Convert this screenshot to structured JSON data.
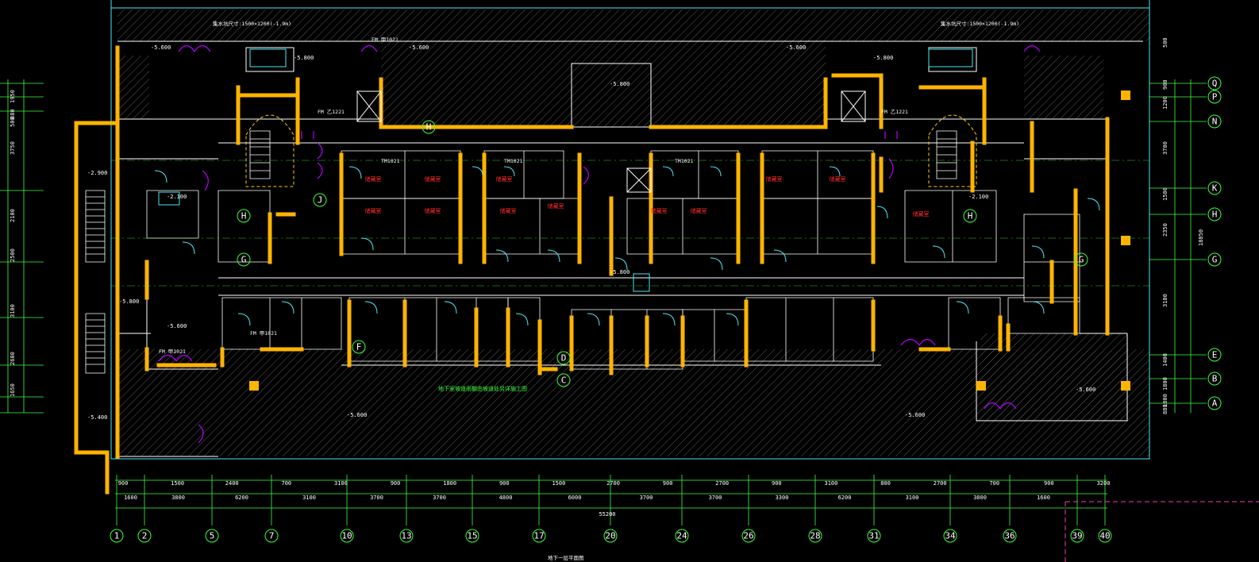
{
  "grid_axes_bottom": [
    "1",
    "2",
    "5",
    "7",
    "10",
    "13",
    "15",
    "17",
    "20",
    "24",
    "26",
    "28",
    "31",
    "34",
    "36",
    "39",
    "40"
  ],
  "grid_axes_right": [
    "Q",
    "P",
    "N",
    "K",
    "H",
    "G",
    "E",
    "B",
    "A"
  ],
  "grid_axes_interior": [
    "H",
    "H",
    "G",
    "G",
    "J",
    "F",
    "D",
    "C",
    "H"
  ],
  "dims_bottom_row1": [
    "900",
    "1500",
    "2400",
    "700",
    "3100",
    "900",
    "1800",
    "900",
    "1500",
    "2700",
    "900",
    "2700",
    "900",
    "3100",
    "800",
    "2700",
    "700",
    "900",
    "3200"
  ],
  "dims_bottom_row2": [
    "1600",
    "3800",
    "6200",
    "3100",
    "3700",
    "3700",
    "4800",
    "6000",
    "3700",
    "3700",
    "3300",
    "6200",
    "3100",
    "3800",
    "1600"
  ],
  "dims_total": "55200",
  "dims_right": [
    "500",
    "900",
    "1200",
    "3700",
    "1500",
    "2350",
    "3100",
    "1400",
    "1800",
    "1800",
    "880"
  ],
  "dims_right_total": "18850",
  "dims_left": [
    "1950",
    "880",
    "500",
    "3750",
    "2100",
    "2500",
    "3100",
    "2600",
    "1650"
  ],
  "rooms": [
    {
      "label": "储藏室"
    },
    {
      "label": "储藏室"
    },
    {
      "label": "储藏室"
    },
    {
      "label": "储藏室"
    },
    {
      "label": "储藏室"
    },
    {
      "label": "储藏室"
    },
    {
      "label": "储藏室"
    },
    {
      "label": "储藏室"
    },
    {
      "label": "储藏室"
    },
    {
      "label": "储藏室"
    },
    {
      "label": "储藏室"
    },
    {
      "label": "储藏室"
    }
  ],
  "elevations": [
    "-5.600",
    "-5.600",
    "-5.600",
    "-5.800",
    "-5.800",
    "-5.800",
    "-2.900",
    "-2.100",
    "-5.400",
    "-5.800",
    "-5.600",
    "-5.600",
    "-5.600",
    "-5.800",
    "-5.600",
    "-2.100"
  ],
  "notes": {
    "ramp": "地下室坡道雨棚由坡道处另详施工图",
    "stair_top_left": "集水坑尺寸:1500×1200(-1.9m)",
    "stair_top_right": "集水坑尺寸:1500×1200(-1.9m)",
    "bottom_title": "地下一层平面图"
  },
  "door_tags": [
    "FM 甲1021",
    "FM 甲1021",
    "FM 乙1221",
    "FM 乙1221",
    "FM 甲1021",
    "TM1021",
    "TM1021",
    "TM1021"
  ],
  "colors": {
    "background": "#000000",
    "wall": "#ffb400",
    "line": "#ffffff",
    "grid": "#3cff3c",
    "door": "#b400ff",
    "cyan": "#4de8f0",
    "room_text": "#ff2a2a"
  }
}
